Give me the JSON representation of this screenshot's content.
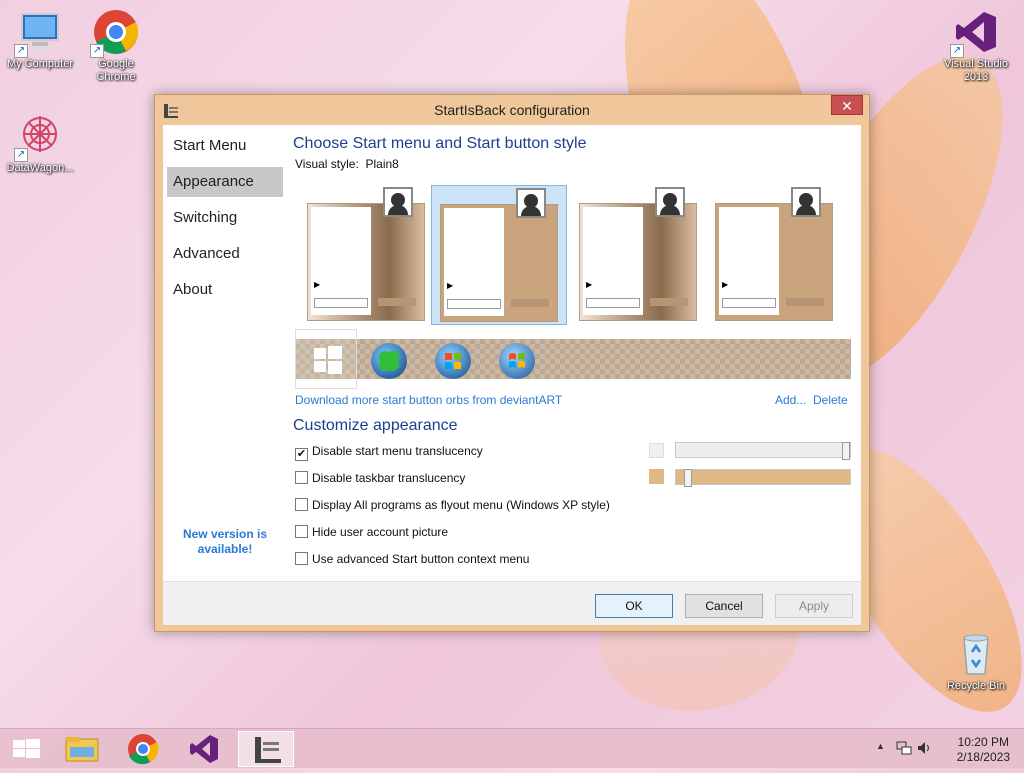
{
  "desktop": {
    "icons": [
      {
        "label": "My Computer"
      },
      {
        "label": "Google Chrome"
      },
      {
        "label": "DataWagon..."
      },
      {
        "label": "Visual Studio 2013"
      },
      {
        "label": "Recycle Bin"
      }
    ]
  },
  "window": {
    "title": "StartIsBack configuration",
    "close_glyph": "✕",
    "sidebar": {
      "items": [
        {
          "label": "Start Menu"
        },
        {
          "label": "Appearance"
        },
        {
          "label": "Switching"
        },
        {
          "label": "Advanced"
        },
        {
          "label": "About"
        }
      ],
      "active": "Appearance",
      "new_version_line1": "New version is",
      "new_version_line2": "available!"
    },
    "style_section": {
      "heading": "Choose Start menu and Start button style",
      "visual_style_label": "Visual style:",
      "visual_style_value": "Plain8",
      "selected_thumb_index": 1,
      "download_link": "Download more start button orbs from deviantART",
      "add_link": "Add...",
      "delete_link": "Delete"
    },
    "customize_section": {
      "heading": "Customize appearance",
      "options": [
        {
          "label": "Disable start menu translucency",
          "checked": true
        },
        {
          "label": "Disable taskbar translucency",
          "checked": false
        },
        {
          "label": "Display All programs as flyout menu (Windows XP style)",
          "checked": false
        },
        {
          "label": "Hide user account picture",
          "checked": false
        },
        {
          "label": "Use advanced Start button context menu",
          "checked": false
        }
      ],
      "start_menu_translucency_level": 1.0,
      "taskbar_translucency_level": 0.05,
      "taskbar_swatch_color": "#deb887"
    },
    "buttons": {
      "ok": "OK",
      "cancel": "Cancel",
      "apply": "Apply"
    }
  },
  "taskbar": {
    "clock_time": "10:20 PM",
    "clock_date": "2/18/2023",
    "tray_chevron": "▲"
  },
  "colors": {
    "window_frame": "#f0c79a",
    "accent_blue": "#1e3f8f",
    "link_blue": "#2a7ad4",
    "close_red": "#c75050"
  }
}
